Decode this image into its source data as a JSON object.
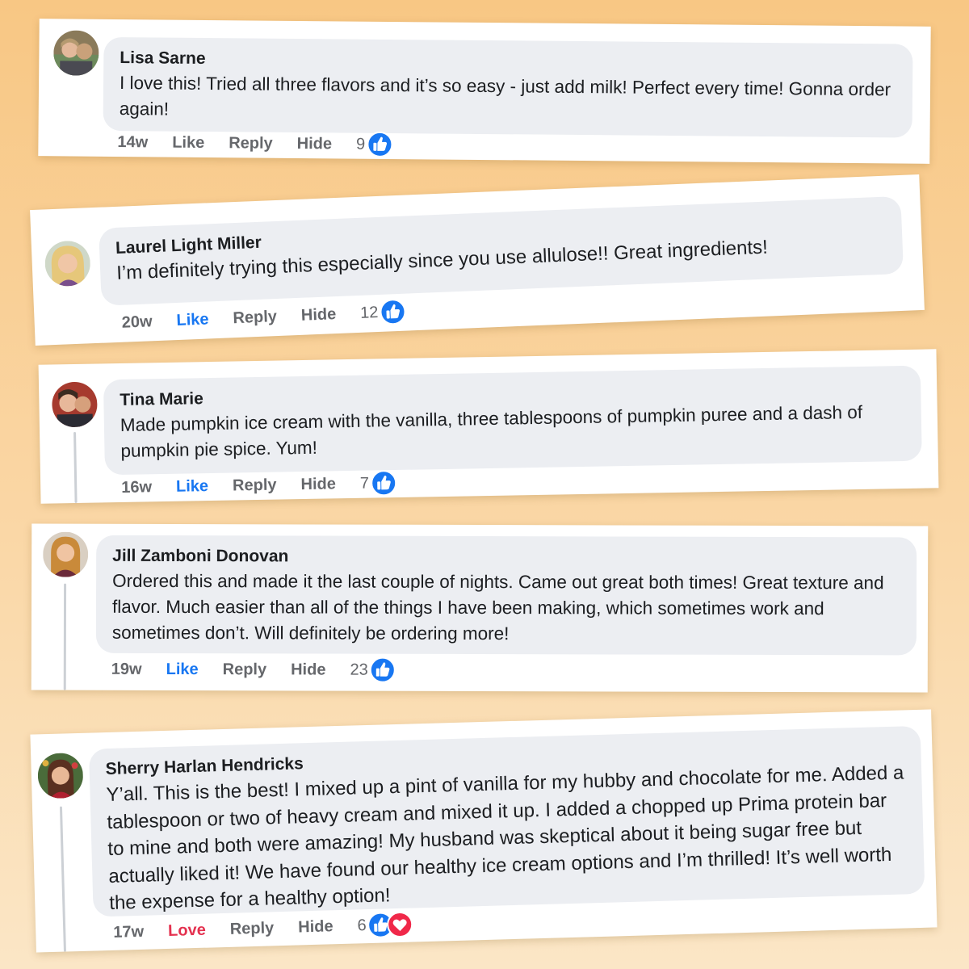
{
  "comments": [
    {
      "name": "Lisa Sarne",
      "text": "I love this! Tried all three flavors and it’s so easy - just add milk! Perfect every time! Gonna order again!",
      "time": "14w",
      "like": "Like",
      "reply": "Reply",
      "hide": "Hide",
      "count": "9",
      "like_state": "none",
      "reactions": [
        "like"
      ]
    },
    {
      "name": "Laurel Light Miller",
      "text": "I’m definitely trying this especially since you use allulose!! Great ingredients!",
      "time": "20w",
      "like": "Like",
      "reply": "Reply",
      "hide": "Hide",
      "count": "12",
      "like_state": "liked",
      "reactions": [
        "like"
      ]
    },
    {
      "name": "Tina Marie",
      "text": "Made pumpkin ice cream with the vanilla, three tablespoons of pumpkin puree and a dash of pumpkin pie spice. Yum!",
      "time": "16w",
      "like": "Like",
      "reply": "Reply",
      "hide": "Hide",
      "count": "7",
      "like_state": "liked",
      "reactions": [
        "like"
      ]
    },
    {
      "name": "Jill Zamboni Donovan",
      "text": "Ordered this and made it the last couple of nights. Came out great both times! Great texture and flavor. Much easier than all of the things I have been making, which sometimes work and sometimes don’t. Will definitely be ordering more!",
      "time": "19w",
      "like": "Like",
      "reply": "Reply",
      "hide": "Hide",
      "count": "23",
      "like_state": "liked",
      "reactions": [
        "like"
      ]
    },
    {
      "name": "Sherry Harlan Hendricks",
      "text": "Y’all. This is the best! I mixed up a pint of vanilla for my hubby and chocolate for me. Added a tablespoon or two of heavy cream and mixed it up. I added a chopped up Prima protein bar to mine and both were amazing! My husband was skeptical about it being sugar free but actually liked it! We have found our healthy ice cream options and I’m thrilled! It’s well worth the expense for a healthy option!",
      "time": "17w",
      "like": "Love",
      "reply": "Reply",
      "hide": "Hide",
      "count": "6",
      "like_state": "loved",
      "reactions": [
        "like",
        "love"
      ]
    }
  ],
  "colors": {
    "like_blue": "#1877f2",
    "love_red": "#e4314f",
    "meta_gray": "#65676b",
    "bubble": "#eceef2"
  },
  "icons": {
    "like": "thumbs-up-icon",
    "love": "heart-icon"
  }
}
